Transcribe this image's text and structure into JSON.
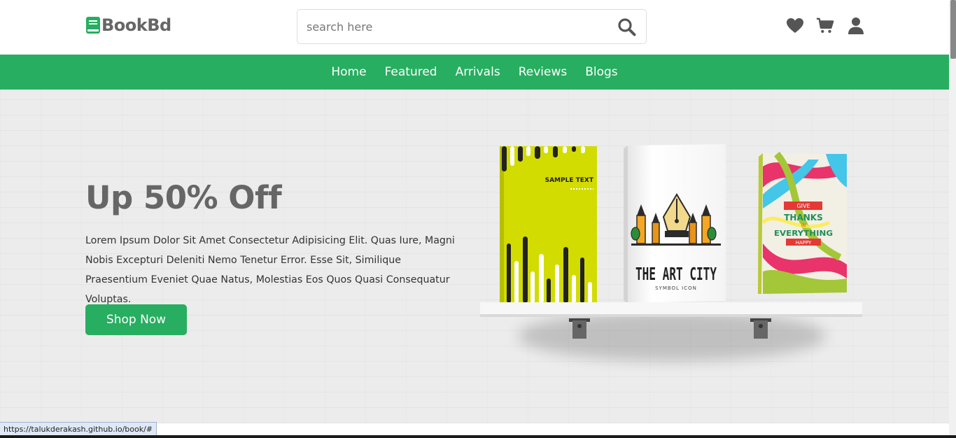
{
  "header": {
    "logo_text": "BookBd",
    "search_placeholder": "search here",
    "icons": [
      "heart-icon",
      "cart-icon",
      "user-icon"
    ]
  },
  "nav": {
    "items": [
      "Home",
      "Featured",
      "Arrivals",
      "Reviews",
      "Blogs"
    ]
  },
  "hero": {
    "title": "Up 50% Off",
    "text": "Lorem Ipsum Dolor Sit Amet Consectetur Adipisicing Elit. Quas Iure, Magni Nobis Excepturi Deleniti Nemo Tenetur Error. Esse Sit, Similique Praesentium Eveniet Quae Natus, Molestias Eos Quos Quasi Consequatur Voluptas.",
    "button": "Shop Now",
    "books": {
      "book1_text": "SAMPLE TEXT",
      "book2_title": "THE ART CITY",
      "book2_subtitle": "SYMBOL ICON",
      "book3_line1": "GIVE",
      "book3_line2": "THANKS",
      "book3_line3": "IN",
      "book3_line4": "EVERYTHING",
      "book3_line5": "HAPPY"
    }
  },
  "status_bar": {
    "url": "https://talukderakash.github.io/book/#"
  },
  "colors": {
    "brand_green": "#27ae60",
    "text_gray": "#666666"
  }
}
